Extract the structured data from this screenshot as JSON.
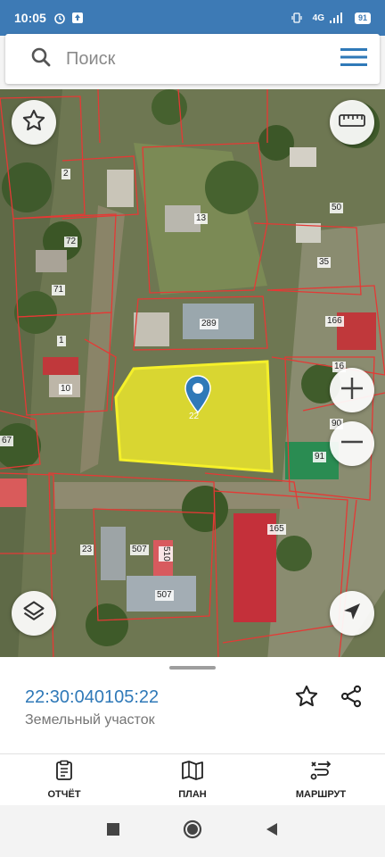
{
  "status_bar": {
    "time": "10:05",
    "network": "4G",
    "battery": "91",
    "icons": [
      "alarm-icon",
      "upload-icon",
      "vibrate-icon",
      "signal-icon"
    ]
  },
  "search": {
    "placeholder": "Поиск",
    "value": ""
  },
  "map": {
    "parcel_labels": [
      "2",
      "13",
      "50",
      "72",
      "35",
      "71",
      "289",
      "166",
      "1",
      "10",
      "16",
      "22",
      "90",
      "67",
      "91",
      "165",
      "23",
      "507",
      "510",
      "507"
    ],
    "selected_parcel_label": "22",
    "highlight_color": "#f0ec2a",
    "boundary_color": "#e53935"
  },
  "sheet": {
    "cadastral_number": "22:30:040105:22",
    "parcel_type": "Земельный участок"
  },
  "nav": {
    "report_label": "ОТЧЁТ",
    "plan_label": "ПЛАН",
    "route_label": "МАРШРУТ"
  },
  "colors": {
    "status_bar": "#3d7ab5",
    "accent": "#2f79b8"
  }
}
